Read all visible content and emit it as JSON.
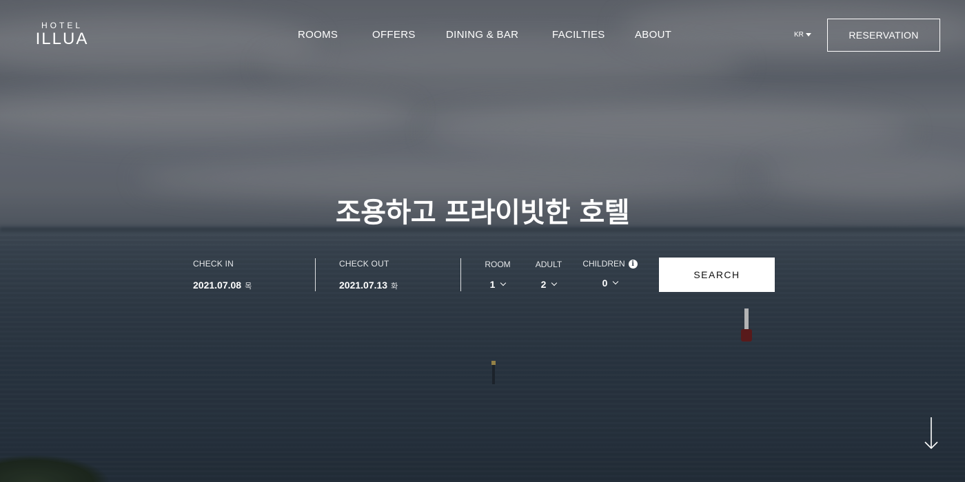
{
  "brand": {
    "logo_small": "HOTEL",
    "logo_big": "ILLUA"
  },
  "nav": {
    "items": [
      {
        "label": "ROOMS"
      },
      {
        "label": "OFFERS"
      },
      {
        "label": "DINING & BAR"
      },
      {
        "label": "FACILTIES"
      },
      {
        "label": "ABOUT"
      }
    ],
    "language": "KR",
    "reservation_label": "RESERVATION"
  },
  "hero": {
    "headline": "조용하고 프라이빗한 호텔"
  },
  "booking": {
    "check_in": {
      "label": "CHECK IN",
      "date": "2021.07.08",
      "weekday": "목"
    },
    "check_out": {
      "label": "CHECK OUT",
      "date": "2021.07.13",
      "weekday": "화"
    },
    "room": {
      "label": "ROOM",
      "value": "1"
    },
    "adult": {
      "label": "ADULT",
      "value": "2"
    },
    "children": {
      "label": "CHILDREN",
      "value": "0",
      "info_symbol": "i"
    },
    "search_label": "SEARCH"
  },
  "icons": {
    "language_caret": "caret-down-icon",
    "select_chevron": "chevron-down-icon",
    "children_info": "info-icon",
    "scroll": "arrow-down-icon"
  },
  "colors": {
    "text": "#ffffff",
    "button_bg": "#ffffff",
    "button_text": "#111111"
  }
}
